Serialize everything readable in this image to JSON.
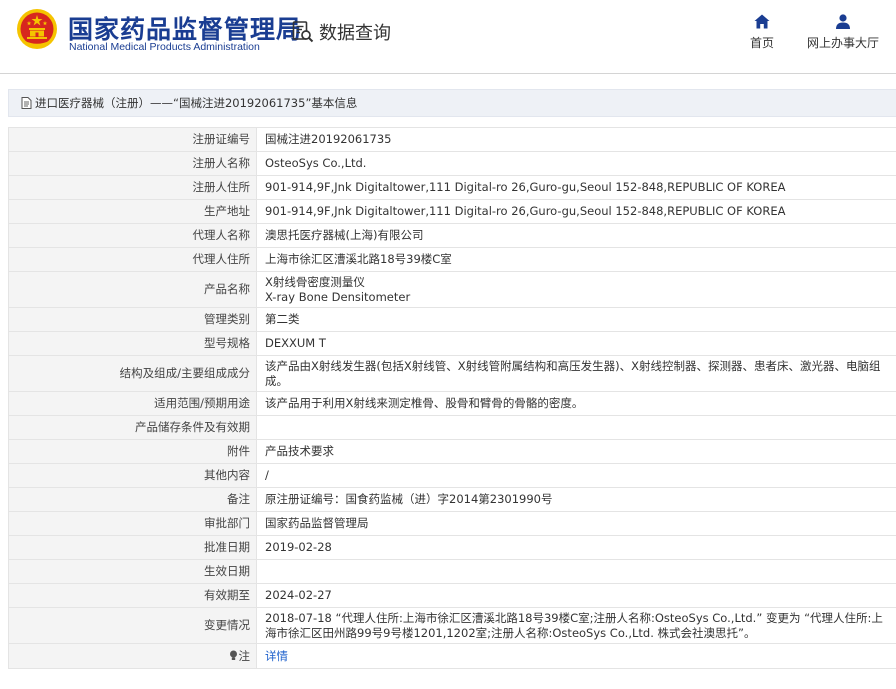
{
  "header": {
    "org_name_cn": "国家药品监督管理局",
    "org_name_en": "National Medical Products Administration",
    "query_title": "数据查询",
    "nav": {
      "home_label": "首页",
      "hall_label": "网上办事大厅"
    }
  },
  "colors": {
    "brand_blue": "#1a3d92",
    "emblem_red": "#d7261e",
    "emblem_gold": "#f5c400",
    "link_blue": "#1a5ecb"
  },
  "breadcrumb": {
    "text": "进口医疗器械（注册）——“国械注进20192061735”基本信息"
  },
  "record": {
    "rows": [
      {
        "label": "注册证编号",
        "value": "国械注进20192061735"
      },
      {
        "label": "注册人名称",
        "value": "OsteoSys Co.,Ltd."
      },
      {
        "label": "注册人住所",
        "value": "901-914,9F,Jnk Digitaltower,111 Digital-ro 26,Guro-gu,Seoul 152-848,REPUBLIC OF KOREA"
      },
      {
        "label": "生产地址",
        "value": "901-914,9F,Jnk Digitaltower,111 Digital-ro 26,Guro-gu,Seoul 152-848,REPUBLIC OF KOREA"
      },
      {
        "label": "代理人名称",
        "value": "澳思托医疗器械(上海)有限公司"
      },
      {
        "label": "代理人住所",
        "value": "上海市徐汇区漕溪北路18号39楼C室"
      },
      {
        "label": "产品名称",
        "value": "X射线骨密度测量仪",
        "value2": "X-ray Bone Densitometer"
      },
      {
        "label": "管理类别",
        "value": "第二类"
      },
      {
        "label": "型号规格",
        "value": "DEXXUM T"
      },
      {
        "label": "结构及组成/主要组成成分",
        "value": "该产品由X射线发生器(包括X射线管、X射线管附属结构和高压发生器)、X射线控制器、探测器、患者床、激光器、电脑组成。"
      },
      {
        "label": "适用范围/预期用途",
        "value": "该产品用于利用X射线来测定椎骨、股骨和臂骨的骨骼的密度。"
      },
      {
        "label": "产品储存条件及有效期",
        "value": ""
      },
      {
        "label": "附件",
        "value": "产品技术要求"
      },
      {
        "label": "其他内容",
        "value": "/"
      },
      {
        "label": "备注",
        "value": "原注册证编号：国食药监械（进）字2014第2301990号"
      },
      {
        "label": "审批部门",
        "value": "国家药品监督管理局"
      },
      {
        "label": "批准日期",
        "value": "2019-02-28"
      },
      {
        "label": "生效日期",
        "value": ""
      },
      {
        "label": "有效期至",
        "value": "2024-02-27"
      },
      {
        "label": "变更情况",
        "value": "2018-07-18 “代理人住所:上海市徐汇区漕溪北路18号39楼C室;注册人名称:OsteoSys Co.,Ltd.” 变更为 “代理人住所:上海市徐汇区田州路99号9号楼1201,1202室;注册人名称:OsteoSys Co.,Ltd. 株式会社澳思托”。"
      },
      {
        "label": "注",
        "value": "详情"
      }
    ]
  }
}
